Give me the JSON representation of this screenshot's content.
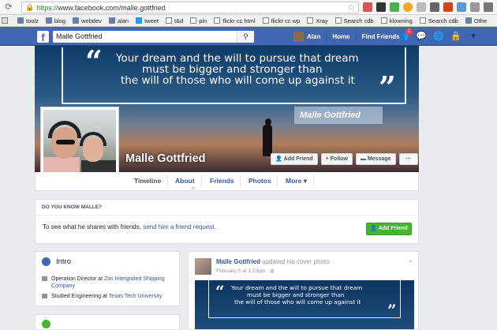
{
  "browser": {
    "url_https": "https://",
    "url_rest": "www.facebook.com/malle.gottfried",
    "bookmarks": [
      "toolz",
      "blog",
      "webdev",
      "alan",
      "tweet",
      "t&d",
      "pin",
      "flickr cc html",
      "flickr cc wp",
      "Xray",
      "Search cdb",
      "klowning",
      "Search cdb",
      "Othe"
    ]
  },
  "fbbar": {
    "logo": "f",
    "search_value": "Malle Gottfried",
    "user": "Alan",
    "home": "Home",
    "find_friends": "Find Friends",
    "friend_requests_count": "2"
  },
  "cover": {
    "quote_line1": "Your dream and the will to pursue that dream",
    "quote_line2": "must be bigger and stronger than",
    "quote_line3": "the will of those who will come up against it",
    "name_banner": "Malle Gottfried",
    "profile_name": "Malle Gottfried",
    "buttons": {
      "add_friend": "Add Friend",
      "follow": "Follow",
      "message": "Message",
      "more": "···"
    }
  },
  "tabs": {
    "timeline": "Timeline",
    "about": "About",
    "friends": "Friends",
    "photos": "Photos",
    "more": "More"
  },
  "dyk": {
    "title": "DO YOU KNOW MALLE?",
    "text_prefix": "To see what he shares with friends,",
    "text_link": "send him a friend request.",
    "button": "Add Friend"
  },
  "intro": {
    "title": "Intro",
    "row1_prefix": "Operation Director at",
    "row1_link": "Zim Intergrated Shipping Company",
    "row2_prefix": "Studied Engineering at",
    "row2_link": "Texas Tech University"
  },
  "post": {
    "author": "Malle Gottfried",
    "action": "updated his cover photo.",
    "date": "February 5 at 1:23pm · ",
    "quote_line1": "Your dream and the will to pursue that dream",
    "quote_line2": "must be bigger and stronger than",
    "quote_line3": "the will of those who will come up against it"
  },
  "colors": {
    "fb_blue": "#4267b2",
    "link_blue": "#365899",
    "add_friend_green": "#42b72a"
  }
}
